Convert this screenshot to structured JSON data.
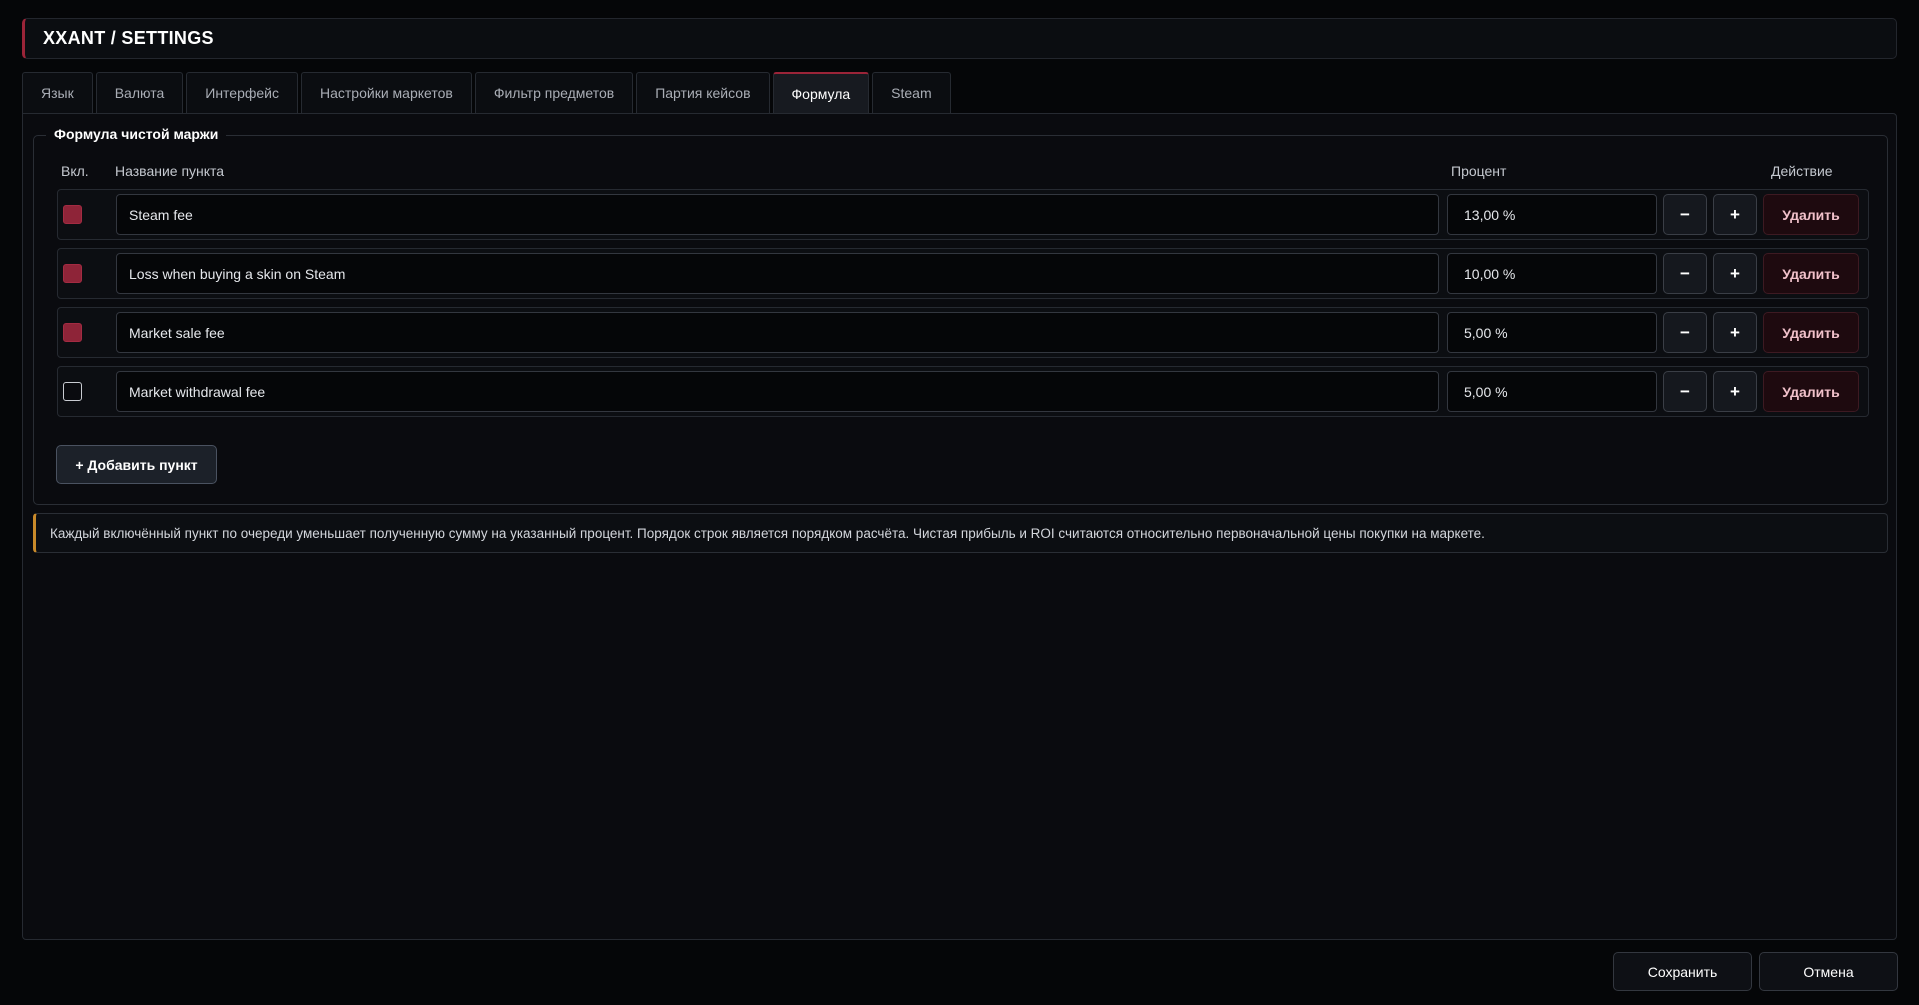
{
  "header": {
    "title": "XXANT  /  SETTINGS"
  },
  "tabs": [
    {
      "label": "Язык"
    },
    {
      "label": "Валюта"
    },
    {
      "label": "Интерфейс"
    },
    {
      "label": "Настройки маркетов"
    },
    {
      "label": "Фильтр предметов"
    },
    {
      "label": "Партия кейсов"
    },
    {
      "label": "Формула",
      "active": true
    },
    {
      "label": "Steam"
    }
  ],
  "formula": {
    "legend": "Формула чистой маржи",
    "columns": {
      "enabled": "Вкл.",
      "name": "Название пункта",
      "percent": "Процент",
      "action": "Действие"
    },
    "rows": [
      {
        "enabled": true,
        "name": "Steam fee",
        "percent": "13,00 %",
        "minus": "−",
        "plus": "+",
        "delete": "Удалить"
      },
      {
        "enabled": true,
        "name": "Loss when buying a skin on Steam",
        "percent": "10,00 %",
        "minus": "−",
        "plus": "+",
        "delete": "Удалить"
      },
      {
        "enabled": true,
        "name": "Market sale fee",
        "percent": "5,00 %",
        "minus": "−",
        "plus": "+",
        "delete": "Удалить"
      },
      {
        "enabled": false,
        "name": "Market withdrawal fee",
        "percent": "5,00 %",
        "minus": "−",
        "plus": "+",
        "delete": "Удалить"
      }
    ],
    "add_label": "+ Добавить пункт"
  },
  "note": "Каждый включённый пункт по очереди уменьшает полученную сумму на указанный процент. Порядок строк является порядком расчёта. Чистая прибыль и ROI считаются относительно первоначальной цены покупки на маркете.",
  "footer": {
    "save_label": "Сохранить",
    "cancel_label": "Отмена"
  },
  "colors": {
    "accent": "#9b2438",
    "note_accent": "#c98a2a",
    "background": "#050608"
  }
}
